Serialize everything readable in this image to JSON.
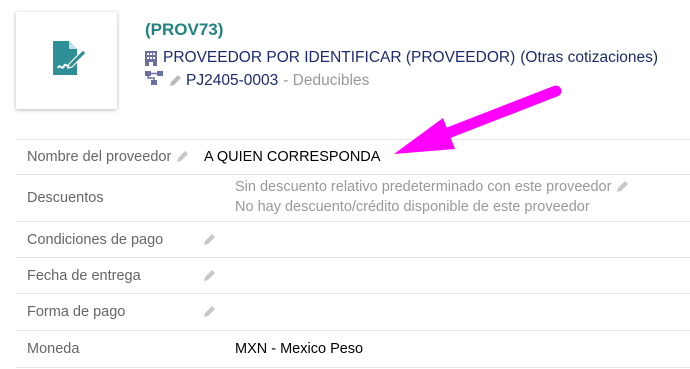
{
  "header": {
    "ref": "(PROV73)",
    "supplier_name": "PROVEEDOR POR IDENTIFICAR (PROVEEDOR)",
    "other_quotes_link": "(Otras cotizaciones)",
    "project_ref": "PJ2405-0003",
    "project_category": "- Deducibles"
  },
  "fields": {
    "supplier_contact_label": "Nombre del proveedor",
    "supplier_contact_value": "A QUIEN CORRESPONDA",
    "discounts_label": "Descuentos",
    "discount_line_1": "Sin descuento relativo predeterminado con este proveedor",
    "discount_line_2": "No hay descuento/crédito disponible de este proveedor",
    "payment_terms_label": "Condiciones de pago",
    "delivery_date_label": "Fecha de entrega",
    "payment_method_label": "Forma de pago",
    "currency_label": "Moneda",
    "currency_value": "MXN - Mexico Peso"
  },
  "colors": {
    "ref": "#218380",
    "link": "#1c2a6c",
    "icon_accent": "#2e8f96",
    "annotation_arrow": "#ff00ff"
  },
  "icons": {
    "thumbnail": "document-signature-icon",
    "supplier": "building-icon",
    "project": "project-tree-icon",
    "edit": "pencil-icon"
  }
}
